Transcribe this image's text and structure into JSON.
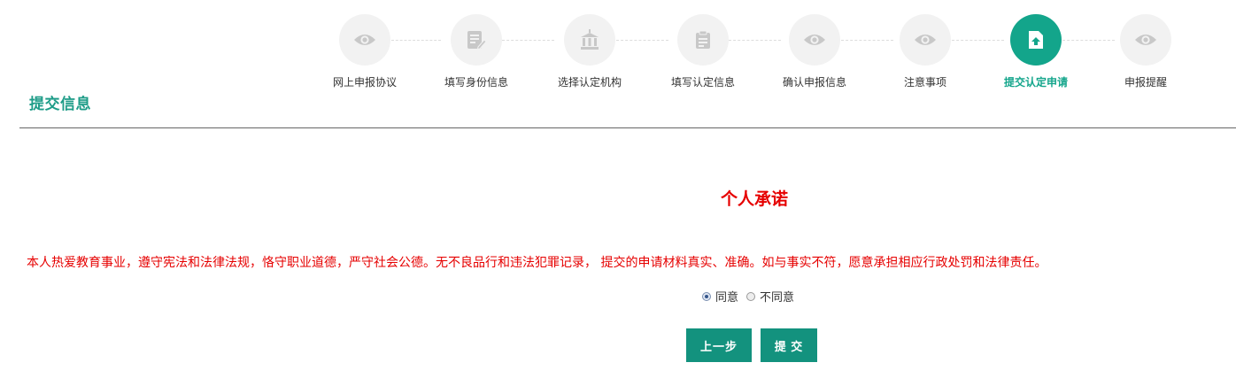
{
  "section_title": "提交信息",
  "steps": [
    {
      "label": "网上申报协议",
      "icon": "eye-icon",
      "active": false
    },
    {
      "label": "填写身份信息",
      "icon": "edit-form-icon",
      "active": false
    },
    {
      "label": "选择认定机构",
      "icon": "institution-icon",
      "active": false
    },
    {
      "label": "填写认定信息",
      "icon": "document-icon",
      "active": false
    },
    {
      "label": "确认申报信息",
      "icon": "eye-icon",
      "active": false
    },
    {
      "label": "注意事项",
      "icon": "eye-icon",
      "active": false
    },
    {
      "label": "提交认定申请",
      "icon": "upload-file-icon",
      "active": true
    },
    {
      "label": "申报提醒",
      "icon": "eye-icon",
      "active": false
    }
  ],
  "pledge": {
    "title": "个人承诺",
    "text": "本人热爱教育事业，遵守宪法和法律法规，恪守职业道德，严守社会公德。无不良品行和违法犯罪记录， 提交的申请材料真实、准确。如与事实不符，愿意承担相应行政处罚和法律责任。"
  },
  "agreement": {
    "agree_label": "同意",
    "disagree_label": "不同意",
    "selected": "agree"
  },
  "buttons": {
    "prev_label": "上一步",
    "submit_label": "提 交"
  },
  "colors": {
    "accent": "#13a58b",
    "button": "#13927e",
    "pledge_red": "#e60000",
    "inactive_icon": "#c8c8c8"
  }
}
